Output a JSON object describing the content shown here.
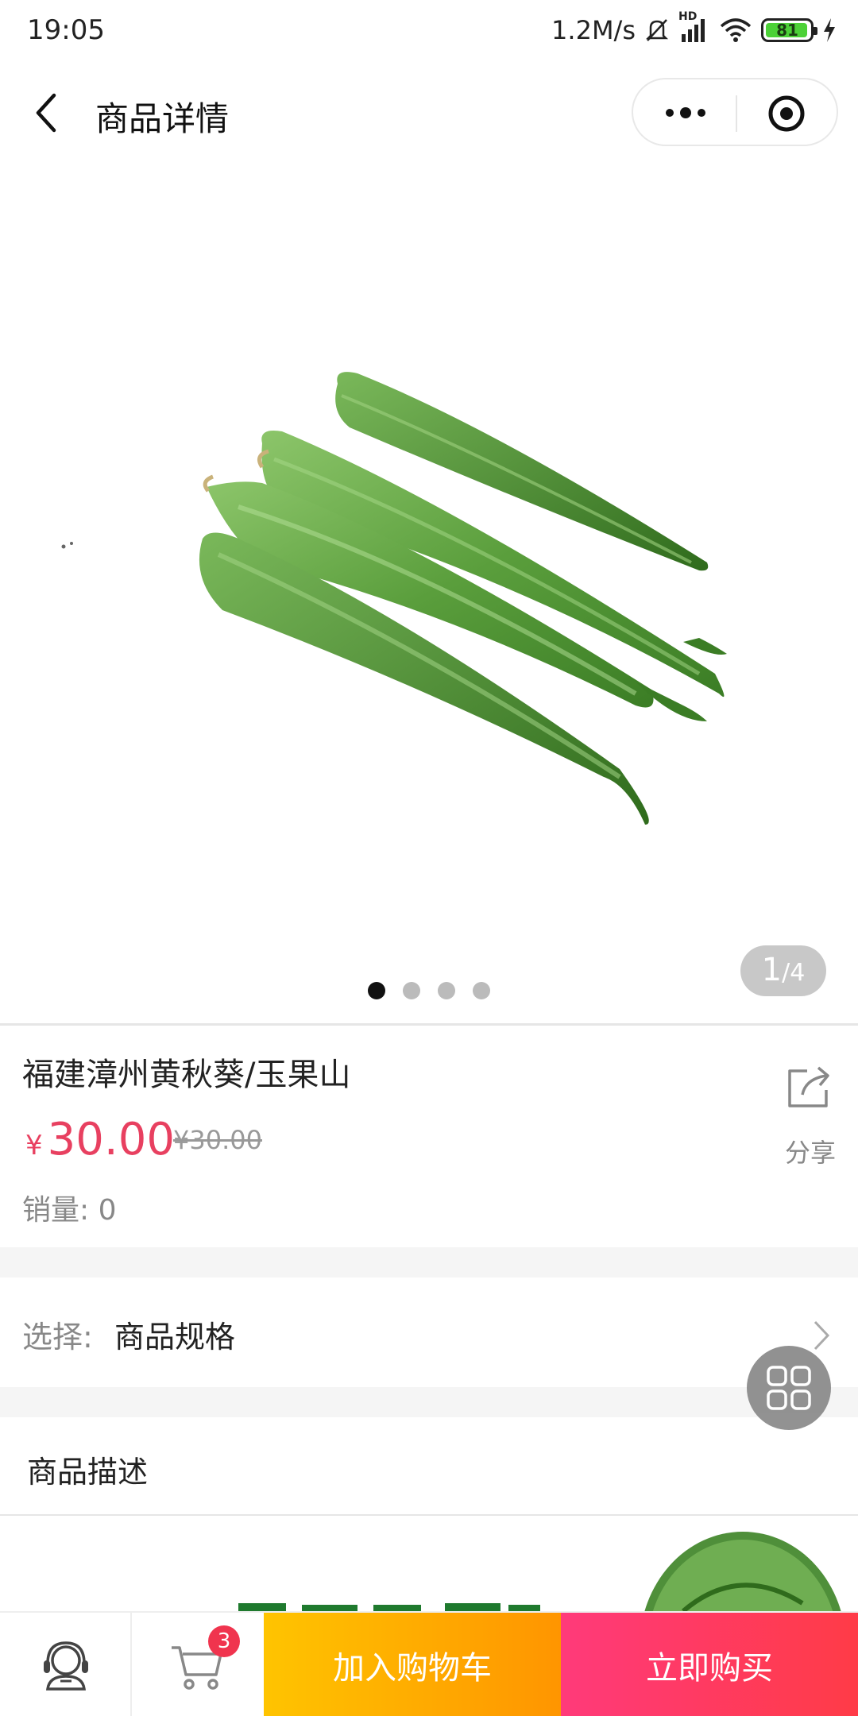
{
  "status_bar": {
    "time": "19:05",
    "network_speed": "1.2M/s",
    "network_type": "HD",
    "battery": "81",
    "icons": [
      "mute-icon",
      "signal-icon",
      "wifi-icon",
      "battery-icon",
      "charging-icon"
    ]
  },
  "nav": {
    "title": "商品详情",
    "back_icon": "chevron-left-icon",
    "more_icon": "more-icon",
    "close_icon": "target-icon"
  },
  "gallery": {
    "current": "1",
    "separator": "/",
    "total": "4",
    "dot_count": 4,
    "active_dot": 0
  },
  "product": {
    "title": "福建漳州黄秋葵/玉果山",
    "currency": "¥",
    "price": "30.00",
    "original_price": "¥30.00",
    "sales_label": "销量:",
    "sales_value": "0",
    "share_label": "分享",
    "price_color": "#e84060"
  },
  "spec": {
    "label": "选择:",
    "value": "商品规格"
  },
  "description": {
    "title": "商品描述"
  },
  "bottom_bar": {
    "cart_count": "3",
    "add_to_cart": "加入购物车",
    "buy_now": "立即购买",
    "service_icon": "customer-service-icon",
    "cart_icon": "cart-icon"
  }
}
